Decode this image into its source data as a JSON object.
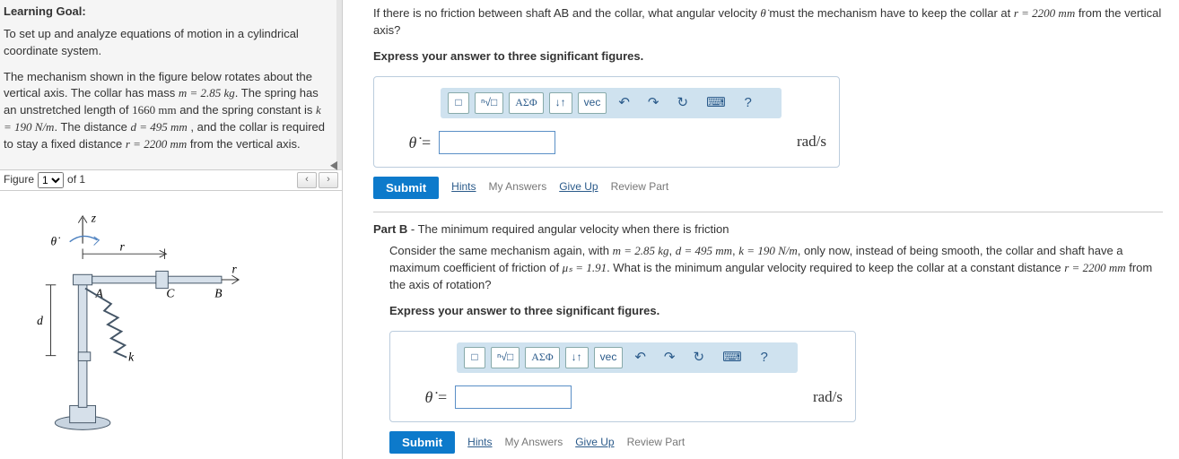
{
  "left": {
    "learning_goal_title": "Learning Goal:",
    "learning_goal_text": "To set up and analyze equations of motion in a cylindrical coordinate system.",
    "problem_intro_1": "The mechanism shown in the figure below rotates about the vertical axis. The collar has mass ",
    "m_expr": "m = 2.85 kg",
    "problem_intro_2": ". The spring has an unstretched length of ",
    "unstretched": "1660 mm",
    "problem_intro_3": " and the spring constant is ",
    "k_expr": "k = 190 N/m",
    "problem_intro_4": ". The distance ",
    "d_expr": "d = 495 mm",
    "problem_intro_5": " , and the collar is required to stay a fixed distance ",
    "r_expr": "r = 2200 mm",
    "problem_intro_6": " from the vertical axis.",
    "figure_label": "Figure",
    "figure_select": "1",
    "figure_of": "of 1",
    "fig": {
      "z": "z",
      "theta": "θ̇",
      "r_top": "r",
      "r_right": "r",
      "A": "A",
      "C": "C",
      "B": "B",
      "d": "d",
      "k": "k"
    }
  },
  "partA": {
    "question_1": "If there is no friction between shaft AB and the collar, what angular velocity ",
    "theta_dot": "θ̇",
    "question_2": " must the mechanism have to keep the collar at ",
    "r_val": "r = 2200 mm",
    "question_3": " from the vertical axis?",
    "instruction": "Express your answer to three significant figures.",
    "lhs": "θ̇ = ",
    "units": "rad/s"
  },
  "toolbar": {
    "template_alt": "□",
    "root": "ⁿ√□",
    "greek": "ΑΣΦ",
    "updown": "↓↑",
    "vec": "vec",
    "undo": "↶",
    "redo": "↷",
    "reset": "↻",
    "keyboard": "⌨",
    "help": "?"
  },
  "submit_row": {
    "submit": "Submit",
    "hints": "Hints",
    "my_answers": "My Answers",
    "give_up": "Give Up",
    "review": "Review Part"
  },
  "partB": {
    "title_label": "Part B",
    "title_text": " - The minimum required angular velocity when there is friction",
    "q1": "Consider the same mechanism again, with ",
    "m": "m = 2.85 kg",
    "q2": ", ",
    "d": "d = 495 mm",
    "q3": ", ",
    "k": "k = 190 N/m",
    "q4": ", only now, instead of being smooth, the collar and shaft have a maximum coefficient of friction of ",
    "mu": "μₛ = 1.91",
    "q5": ". What is the minimum angular velocity required to keep the collar at a constant distance ",
    "r": "r = 2200 mm",
    "q6": " from the axis of rotation?",
    "instruction": "Express your answer to three significant figures.",
    "lhs": "θ̇ = ",
    "units": "rad/s"
  }
}
